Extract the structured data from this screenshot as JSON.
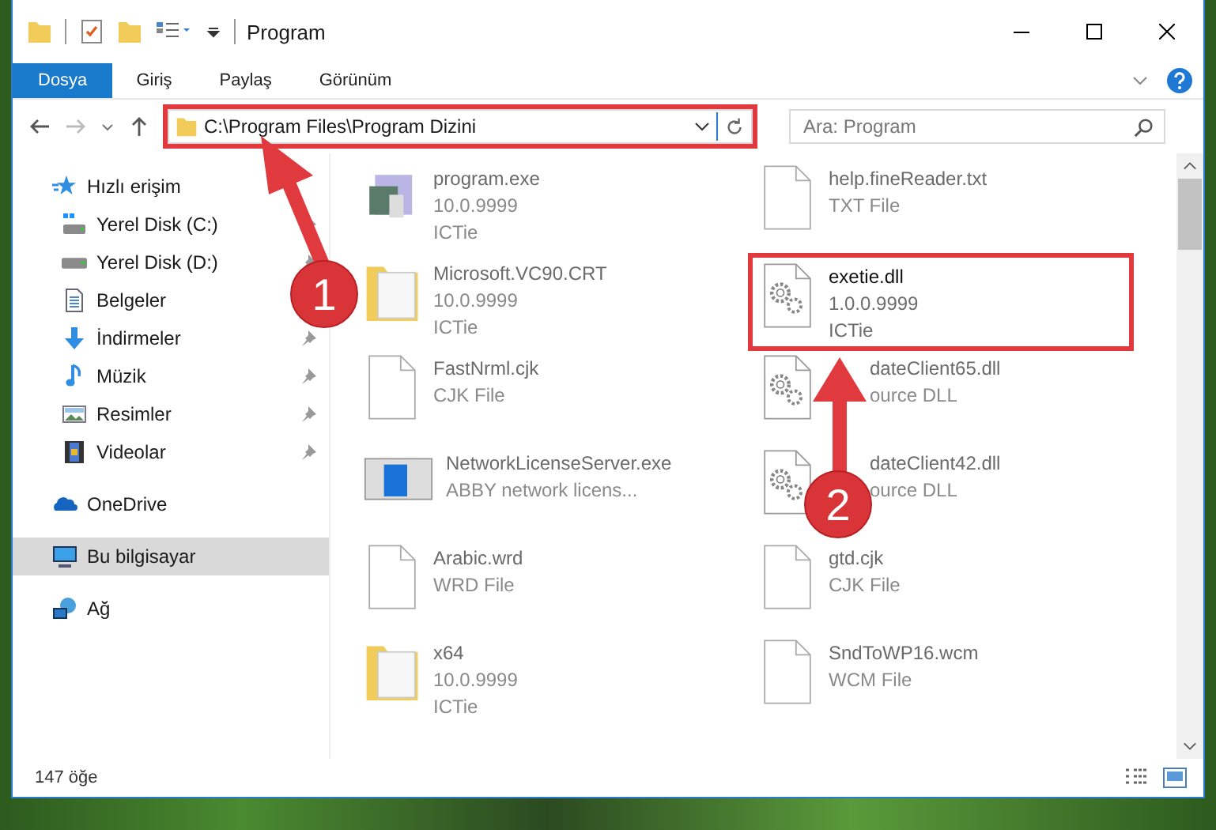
{
  "window": {
    "title": "Program"
  },
  "ribbon_tabs": [
    {
      "label": "Dosya",
      "kind": "file"
    },
    {
      "label": "Giriş",
      "kind": "tab"
    },
    {
      "label": "Paylaş",
      "kind": "tab"
    },
    {
      "label": "Görünüm",
      "kind": "tab"
    }
  ],
  "address_bar": {
    "path": "C:\\Program Files\\Program Dizini",
    "highlighted": true
  },
  "search": {
    "placeholder": "Ara: Program"
  },
  "sidebar": {
    "items": [
      {
        "label": "Hızlı erişim",
        "kind": "quick-access",
        "selected": false,
        "children": [
          {
            "label": "Yerel Disk (C:)",
            "kind": "system-drive",
            "pinned": true,
            "selected": false
          },
          {
            "label": "Yerel Disk (D:)",
            "kind": "drive",
            "pinned": true,
            "selected": false
          },
          {
            "label": "Belgeler",
            "kind": "documents",
            "pinned": false,
            "selected": false
          },
          {
            "label": "İndirmeler",
            "kind": "downloads",
            "pinned": true,
            "selected": false
          },
          {
            "label": "Müzik",
            "kind": "music",
            "pinned": true,
            "selected": false
          },
          {
            "label": "Resimler",
            "kind": "pictures",
            "pinned": true,
            "selected": false
          },
          {
            "label": "Videolar",
            "kind": "videos",
            "pinned": true,
            "selected": false
          }
        ]
      },
      {
        "label": "OneDrive",
        "kind": "cloud",
        "selected": false
      },
      {
        "label": "Bu bilgisayar",
        "kind": "computer",
        "selected": true
      },
      {
        "label": "Ağ",
        "kind": "network",
        "selected": false
      }
    ]
  },
  "files": [
    {
      "name": "program.exe",
      "details": [
        "10.0.9999",
        "ICTie"
      ],
      "kind": "app",
      "blurred": true,
      "highlighted": false,
      "covered": false
    },
    {
      "name": "help.fineReader.txt",
      "details": [
        "TXT File"
      ],
      "kind": "file",
      "blurred": true,
      "highlighted": false,
      "covered": false
    },
    {
      "name": "Microsoft.VC90.CRT",
      "details": [
        "10.0.9999",
        "ICTie"
      ],
      "kind": "folder",
      "blurred": true,
      "highlighted": false,
      "covered": false
    },
    {
      "name": "exetie.dll",
      "details": [
        "1.0.0.9999",
        "ICTie"
      ],
      "kind": "library",
      "blurred": false,
      "highlighted": true,
      "covered": false
    },
    {
      "name": "FastNrml.cjk",
      "details": [
        "CJK File"
      ],
      "kind": "file",
      "blurred": true,
      "highlighted": false,
      "covered": false
    },
    {
      "name": "dateClient65.dll",
      "details": [
        "ource DLL"
      ],
      "kind": "library",
      "blurred": true,
      "highlighted": false,
      "covered": true
    },
    {
      "name": "NetworkLicenseServer.exe",
      "details": [
        "ABBY network licens..."
      ],
      "kind": "window",
      "blurred": true,
      "highlighted": false,
      "covered": false
    },
    {
      "name": "dateClient42.dll",
      "details": [
        "ource DLL"
      ],
      "kind": "library",
      "blurred": true,
      "highlighted": false,
      "covered": true
    },
    {
      "name": "Arabic.wrd",
      "details": [
        "WRD File"
      ],
      "kind": "file",
      "blurred": true,
      "highlighted": false,
      "covered": false
    },
    {
      "name": "gtd.cjk",
      "details": [
        "CJK File"
      ],
      "kind": "file",
      "blurred": true,
      "highlighted": false,
      "covered": false
    },
    {
      "name": "x64",
      "details": [
        "10.0.9999",
        "ICTie"
      ],
      "kind": "folder",
      "blurred": true,
      "highlighted": false,
      "covered": false
    },
    {
      "name": "SndToWP16.wcm",
      "details": [
        "WCM File"
      ],
      "kind": "file",
      "blurred": true,
      "highlighted": false,
      "covered": false
    }
  ],
  "status_bar": {
    "count": "147 öğe"
  },
  "annotations": [
    {
      "label": "1"
    },
    {
      "label": "2"
    }
  ]
}
